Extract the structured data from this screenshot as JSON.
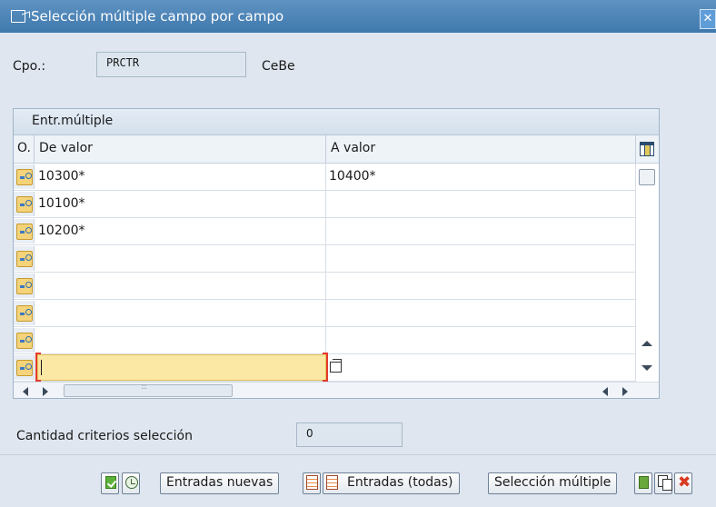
{
  "window": {
    "title": "Selección múltiple campo por campo",
    "close_icon": "close-icon"
  },
  "field": {
    "label": "Cpo.:",
    "value": "PRCTR",
    "description": "CeBe"
  },
  "table": {
    "title": "Entr.múltiple",
    "columns": {
      "option": "O.",
      "from": "De valor",
      "to": "A valor"
    },
    "rows": [
      {
        "from": "10300*",
        "to": "10400*"
      },
      {
        "from": "10100*",
        "to": ""
      },
      {
        "from": "10200*",
        "to": ""
      },
      {
        "from": "",
        "to": ""
      },
      {
        "from": "",
        "to": ""
      },
      {
        "from": "",
        "to": ""
      },
      {
        "from": "",
        "to": ""
      },
      {
        "from": "",
        "to": ""
      }
    ],
    "active_row_index": 7
  },
  "criteria": {
    "label": "Cantidad criterios selección",
    "value": "0"
  },
  "toolbar": {
    "new_entries": "Entradas nuevas",
    "all_entries": "Entradas (todas)",
    "multiple_selection": "Selección múltiple"
  },
  "colors": {
    "titlebar": "#4a86bb",
    "active_cell": "#fbe8a5",
    "accent_red": "#e23a2e"
  }
}
